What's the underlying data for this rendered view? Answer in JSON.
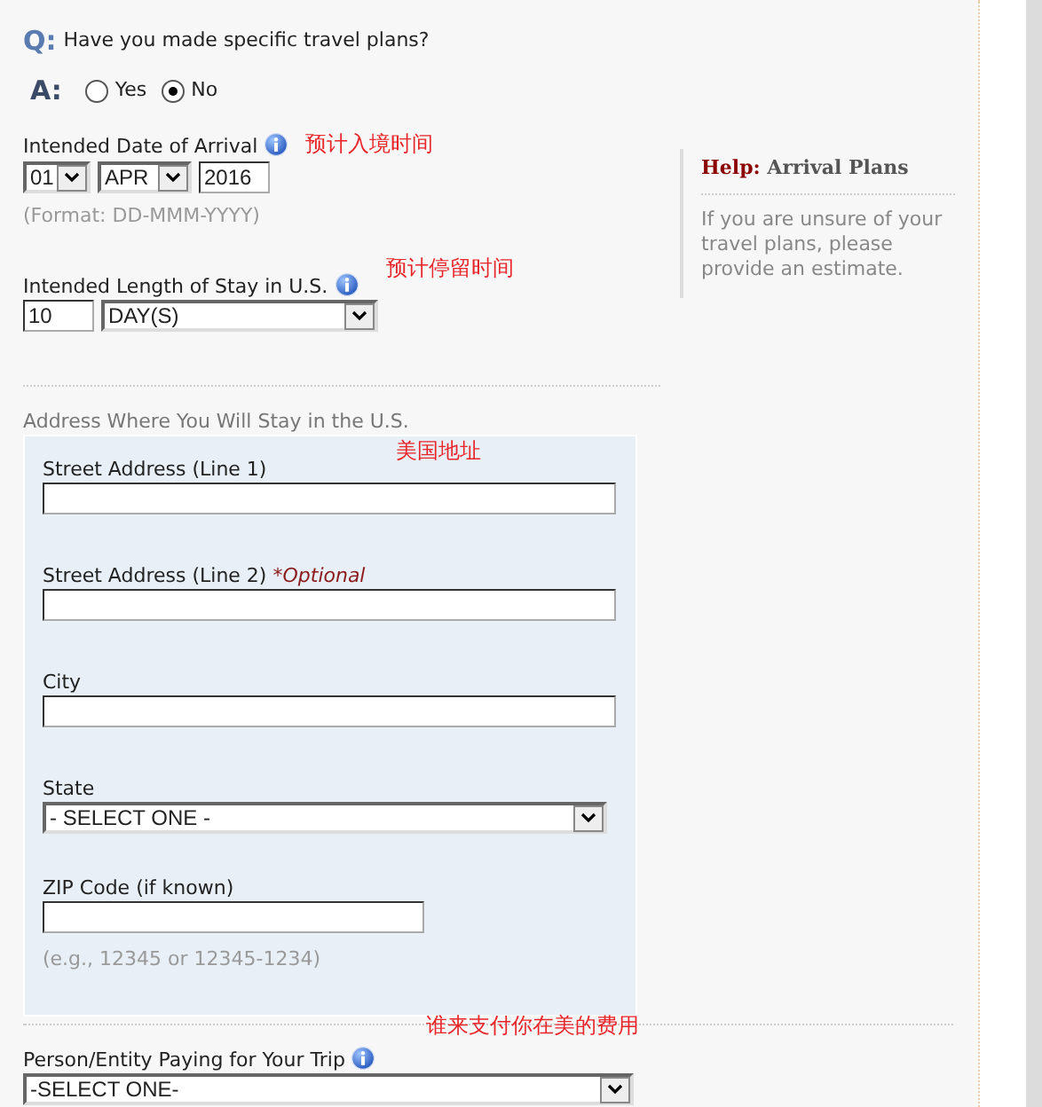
{
  "question": {
    "prefix": "Q:",
    "text": "Have you made specific travel plans?"
  },
  "answer": {
    "prefix": "A:",
    "options": [
      {
        "label": "Yes",
        "selected": false
      },
      {
        "label": "No",
        "selected": true
      }
    ]
  },
  "arrival_date": {
    "label": "Intended Date of Arrival",
    "annotation": "预计入境时间",
    "day": "01",
    "month": "APR",
    "year": "2016",
    "format_hint": "(Format: DD-MMM-YYYY)"
  },
  "length_of_stay": {
    "label": "Intended Length of Stay in U.S.",
    "annotation": "预计停留时间",
    "number": "10",
    "unit": "DAY(S)"
  },
  "address": {
    "heading": "Address Where You Will Stay in the U.S.",
    "annotation": "美国地址",
    "fields": [
      {
        "kind": "text",
        "label": "Street Address (Line 1)"
      },
      {
        "kind": "text",
        "label": "Street Address (Line 2)",
        "note": "*Optional"
      },
      {
        "kind": "text",
        "label": "City"
      },
      {
        "kind": "select",
        "label": "State",
        "value": "- SELECT ONE -"
      },
      {
        "kind": "short",
        "label": "ZIP Code (if known)",
        "hint": "(e.g., 12345 or 12345-1234)"
      }
    ]
  },
  "payer": {
    "label": "Person/Entity Paying for Your Trip",
    "annotation": "谁来支付你在美的费用",
    "value": "-SELECT ONE-"
  },
  "help": {
    "label": "Help:",
    "title": "Arrival Plans",
    "text": "If you are unsure of your travel plans, please provide an estimate."
  }
}
